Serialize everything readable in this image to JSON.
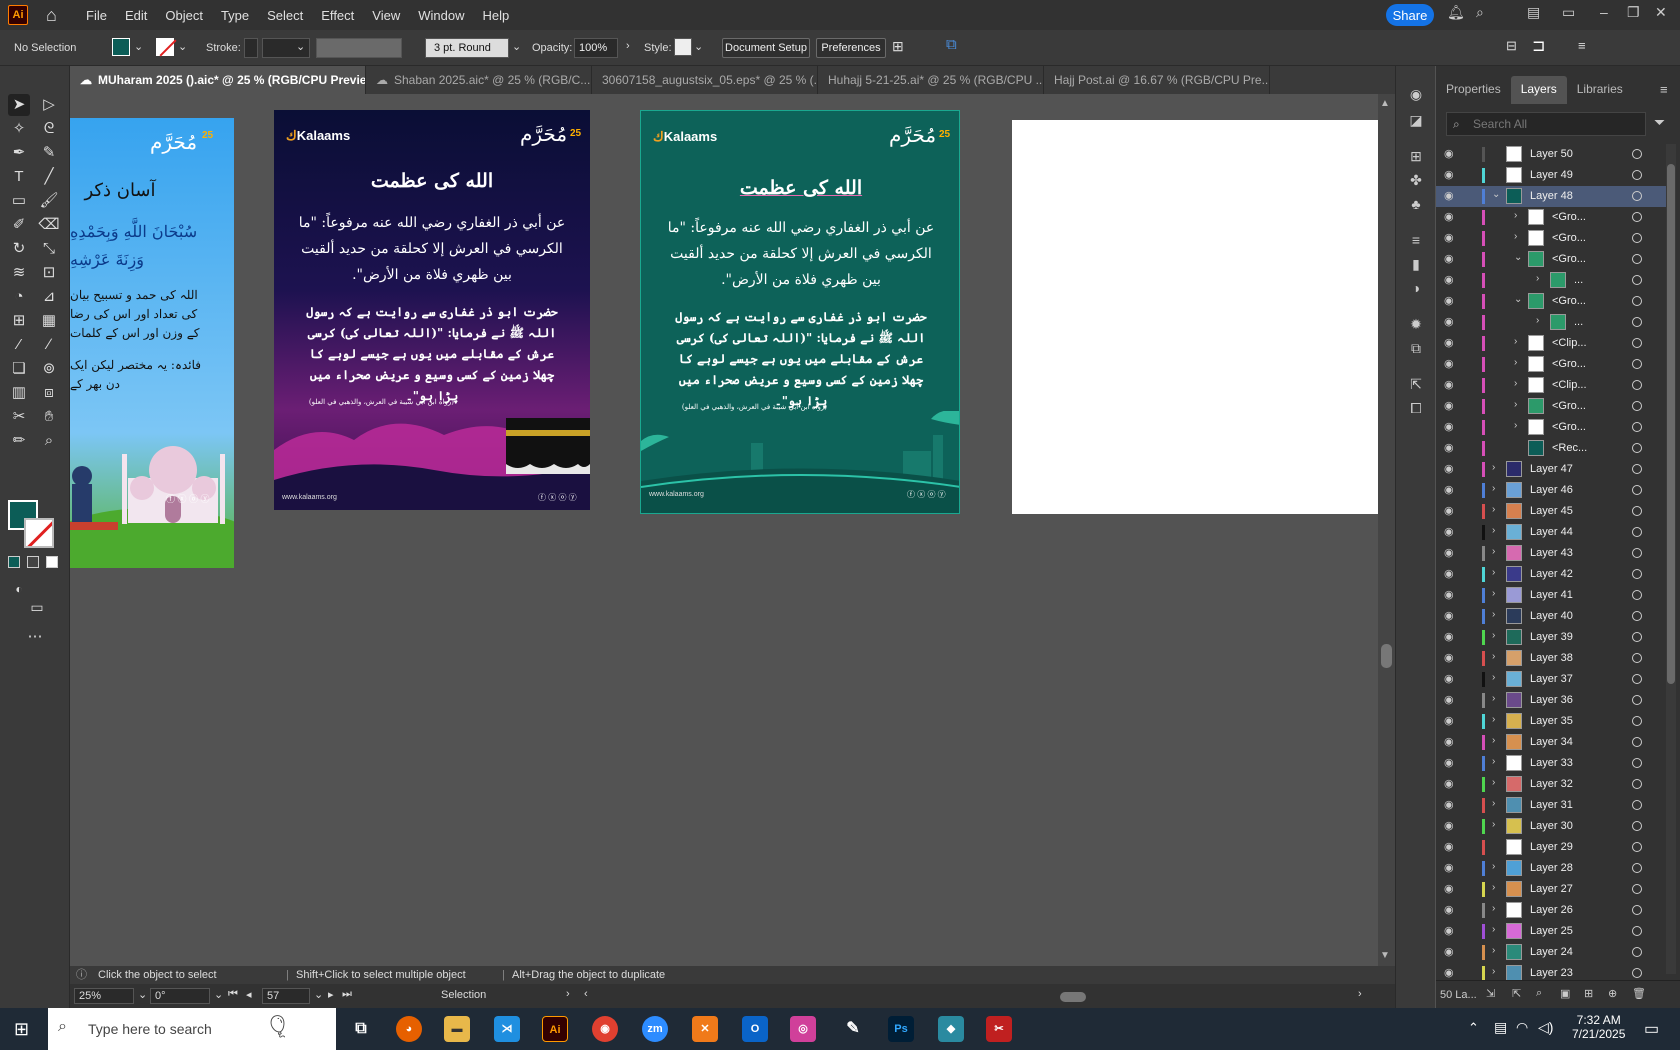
{
  "app": {
    "logo": "Ai",
    "menus": [
      "File",
      "Edit",
      "Object",
      "Type",
      "Select",
      "Effect",
      "View",
      "Window",
      "Help"
    ],
    "share": "Share"
  },
  "control": {
    "selection": "No Selection",
    "stroke_label": "Stroke:",
    "brush": "3 pt. Round",
    "opacity_label": "Opacity:",
    "opacity": "100%",
    "style_label": "Style:",
    "doc_setup": "Document Setup",
    "preferences": "Preferences"
  },
  "tabs": [
    {
      "label": "MUharam 2025 ().aic* @ 25 % (RGB/CPU Preview)",
      "active": true
    },
    {
      "label": "Shaban 2025.aic* @ 25 % (RGB/C...",
      "active": false
    },
    {
      "label": "30607158_augustsix_05.eps* @ 25 % (...",
      "active": false
    },
    {
      "label": "Huhajj 5-21-25.ai* @ 25 % (RGB/CPU ...",
      "active": false
    },
    {
      "label": "Hajj Post.ai @ 16.67 % (RGB/CPU Pre...",
      "active": false
    }
  ],
  "artboards": {
    "brand": "Kalaams",
    "muharram": "مُحَرَّم",
    "num25": "25",
    "title": "الله کی عظمت",
    "arabic": "عن أبي ذر الغفاري رضي الله عنه مرفوعاً: \"ما الكرسي في العرش إلا كحلقة من حديد ألقيت بين ظهري فلاة من الأرض\".",
    "urdu": "حضرت ابو ذر غفاری سے روایت ہے کہ رسول اللہ ﷺ نے فرمایا: \"(اللہ تعالی کی) کرسی عرش کے مقابلے میں یوں ہے جیسے لوہے کا چھلا زمین کے کسی وسیع و عریض صحراء میں پڑا ہو\"۔",
    "ref": "(رواه ابن أبي شيبة في العرش، والذهبي في العلو)",
    "site": "www.kalaams.org",
    "partial_title": "آسان ذکر",
    "partial_arabic": "سُبْحَانَ اللَّهِ وَبِحَمْدِهِ وَزِنَةَ عَرْشِهِ",
    "partial_urdu": "اللہ کی حمد و تسبیح بیان کی تعداد اور اس کی رضا کے وزن اور اس کے کلمات",
    "partial_note": "فائدہ: یہ مختصر لیکن ایک دن بھر کے"
  },
  "panel": {
    "tabs": [
      "Properties",
      "Layers",
      "Libraries"
    ],
    "search_placeholder": "Search All",
    "layers": [
      {
        "name": "Layer 50",
        "indent": 0,
        "arrow": "",
        "color": "#555555",
        "thumb": "#ffffff"
      },
      {
        "name": "Layer 49",
        "indent": 0,
        "arrow": "",
        "color": "#4fd6d6",
        "thumb": "#ffffff"
      },
      {
        "name": "Layer 48",
        "indent": 0,
        "arrow": "⌄",
        "color": "#4f7fd6",
        "thumb": "#0c5d57",
        "selected": true
      },
      {
        "name": "<Gro...",
        "indent": 1,
        "arrow": "›",
        "color": "#d64fb8",
        "thumb": "#ffffff"
      },
      {
        "name": "<Gro...",
        "indent": 1,
        "arrow": "›",
        "color": "#d64fb8",
        "thumb": "#ffffff"
      },
      {
        "name": "<Gro...",
        "indent": 1,
        "arrow": "⌄",
        "color": "#d64fb8",
        "thumb": "#2c9a6a"
      },
      {
        "name": "...",
        "indent": 2,
        "arrow": "›",
        "color": "#d64fb8",
        "thumb": "#2c9a6a"
      },
      {
        "name": "<Gro...",
        "indent": 1,
        "arrow": "⌄",
        "color": "#d64fb8",
        "thumb": "#2c9a6a"
      },
      {
        "name": "...",
        "indent": 2,
        "arrow": "›",
        "color": "#d64fb8",
        "thumb": "#2c9a6a"
      },
      {
        "name": "<Clip...",
        "indent": 1,
        "arrow": "›",
        "color": "#d64fb8",
        "thumb": "#ffffff"
      },
      {
        "name": "<Gro...",
        "indent": 1,
        "arrow": "›",
        "color": "#d64fb8",
        "thumb": "#ffffff"
      },
      {
        "name": "<Clip...",
        "indent": 1,
        "arrow": "›",
        "color": "#d64fb8",
        "thumb": "#ffffff"
      },
      {
        "name": "<Gro...",
        "indent": 1,
        "arrow": "›",
        "color": "#d64fb8",
        "thumb": "#2c9a6a"
      },
      {
        "name": "<Gro...",
        "indent": 1,
        "arrow": "›",
        "color": "#d64fb8",
        "thumb": "#ffffff"
      },
      {
        "name": "<Rec...",
        "indent": 1,
        "arrow": "",
        "color": "#d64fb8",
        "thumb": "#0c5d57"
      },
      {
        "name": "Layer 47",
        "indent": 0,
        "arrow": "›",
        "color": "#d64fb8",
        "thumb": "#2b2b6a"
      },
      {
        "name": "Layer 46",
        "indent": 0,
        "arrow": "›",
        "color": "#4f7fd6",
        "thumb": "#6aa0d6"
      },
      {
        "name": "Layer 45",
        "indent": 0,
        "arrow": "›",
        "color": "#d64f4f",
        "thumb": "#d6804f"
      },
      {
        "name": "Layer 44",
        "indent": 0,
        "arrow": "›",
        "color": "#111111",
        "thumb": "#6ab0d6"
      },
      {
        "name": "Layer 43",
        "indent": 0,
        "arrow": "›",
        "color": "#888888",
        "thumb": "#d66ab0"
      },
      {
        "name": "Layer 42",
        "indent": 0,
        "arrow": "›",
        "color": "#4fd6d6",
        "thumb": "#3a3a8a"
      },
      {
        "name": "Layer 41",
        "indent": 0,
        "arrow": "›",
        "color": "#4f7fd6",
        "thumb": "#9a9ad6"
      },
      {
        "name": "Layer 40",
        "indent": 0,
        "arrow": "›",
        "color": "#4f7fd6",
        "thumb": "#2b3b5a"
      },
      {
        "name": "Layer 39",
        "indent": 0,
        "arrow": "›",
        "color": "#4fd64f",
        "thumb": "#1e6a5a"
      },
      {
        "name": "Layer 38",
        "indent": 0,
        "arrow": "›",
        "color": "#d64f4f",
        "thumb": "#d6a06a"
      },
      {
        "name": "Layer 37",
        "indent": 0,
        "arrow": "›",
        "color": "#111111",
        "thumb": "#6ab0d6"
      },
      {
        "name": "Layer 36",
        "indent": 0,
        "arrow": "›",
        "color": "#888888",
        "thumb": "#6a4a8a"
      },
      {
        "name": "Layer 35",
        "indent": 0,
        "arrow": "›",
        "color": "#4fd6d6",
        "thumb": "#d6b04f"
      },
      {
        "name": "Layer 34",
        "indent": 0,
        "arrow": "›",
        "color": "#d64fb8",
        "thumb": "#d6904f"
      },
      {
        "name": "Layer 33",
        "indent": 0,
        "arrow": "›",
        "color": "#4f7fd6",
        "thumb": "#ffffff"
      },
      {
        "name": "Layer 32",
        "indent": 0,
        "arrow": "›",
        "color": "#4fd64f",
        "thumb": "#d66a6a"
      },
      {
        "name": "Layer 31",
        "indent": 0,
        "arrow": "›",
        "color": "#d64f4f",
        "thumb": "#4f8fb0"
      },
      {
        "name": "Layer 30",
        "indent": 0,
        "arrow": "›",
        "color": "#4fd64f",
        "thumb": "#d6c04f"
      },
      {
        "name": "Layer 29",
        "indent": 0,
        "arrow": "",
        "color": "#d64f4f",
        "thumb": "#ffffff"
      },
      {
        "name": "Layer 28",
        "indent": 0,
        "arrow": "›",
        "color": "#4f7fd6",
        "thumb": "#4fa0d6"
      },
      {
        "name": "Layer 27",
        "indent": 0,
        "arrow": "›",
        "color": "#d6d64f",
        "thumb": "#d6904f"
      },
      {
        "name": "Layer 26",
        "indent": 0,
        "arrow": "›",
        "color": "#888888",
        "thumb": "#ffffff"
      },
      {
        "name": "Layer 25",
        "indent": 0,
        "arrow": "›",
        "color": "#a04fd6",
        "thumb": "#d66ad6"
      },
      {
        "name": "Layer 24",
        "indent": 0,
        "arrow": "›",
        "color": "#d6904f",
        "thumb": "#2b8a7a"
      },
      {
        "name": "Layer 23",
        "indent": 0,
        "arrow": "›",
        "color": "#d6d64f",
        "thumb": "#4f8fb0"
      }
    ],
    "footer": "50 La..."
  },
  "hint": {
    "t1": "Click the object to select",
    "t2": "Shift+Click to select multiple object",
    "t3": "Alt+Drag the object to duplicate"
  },
  "status": {
    "zoom": "25%",
    "angle": "0°",
    "artboard": "57",
    "mode": "Selection"
  },
  "taskbar": {
    "search": "Type here to search",
    "time": "7:32 AM",
    "date": "7/21/2025"
  }
}
